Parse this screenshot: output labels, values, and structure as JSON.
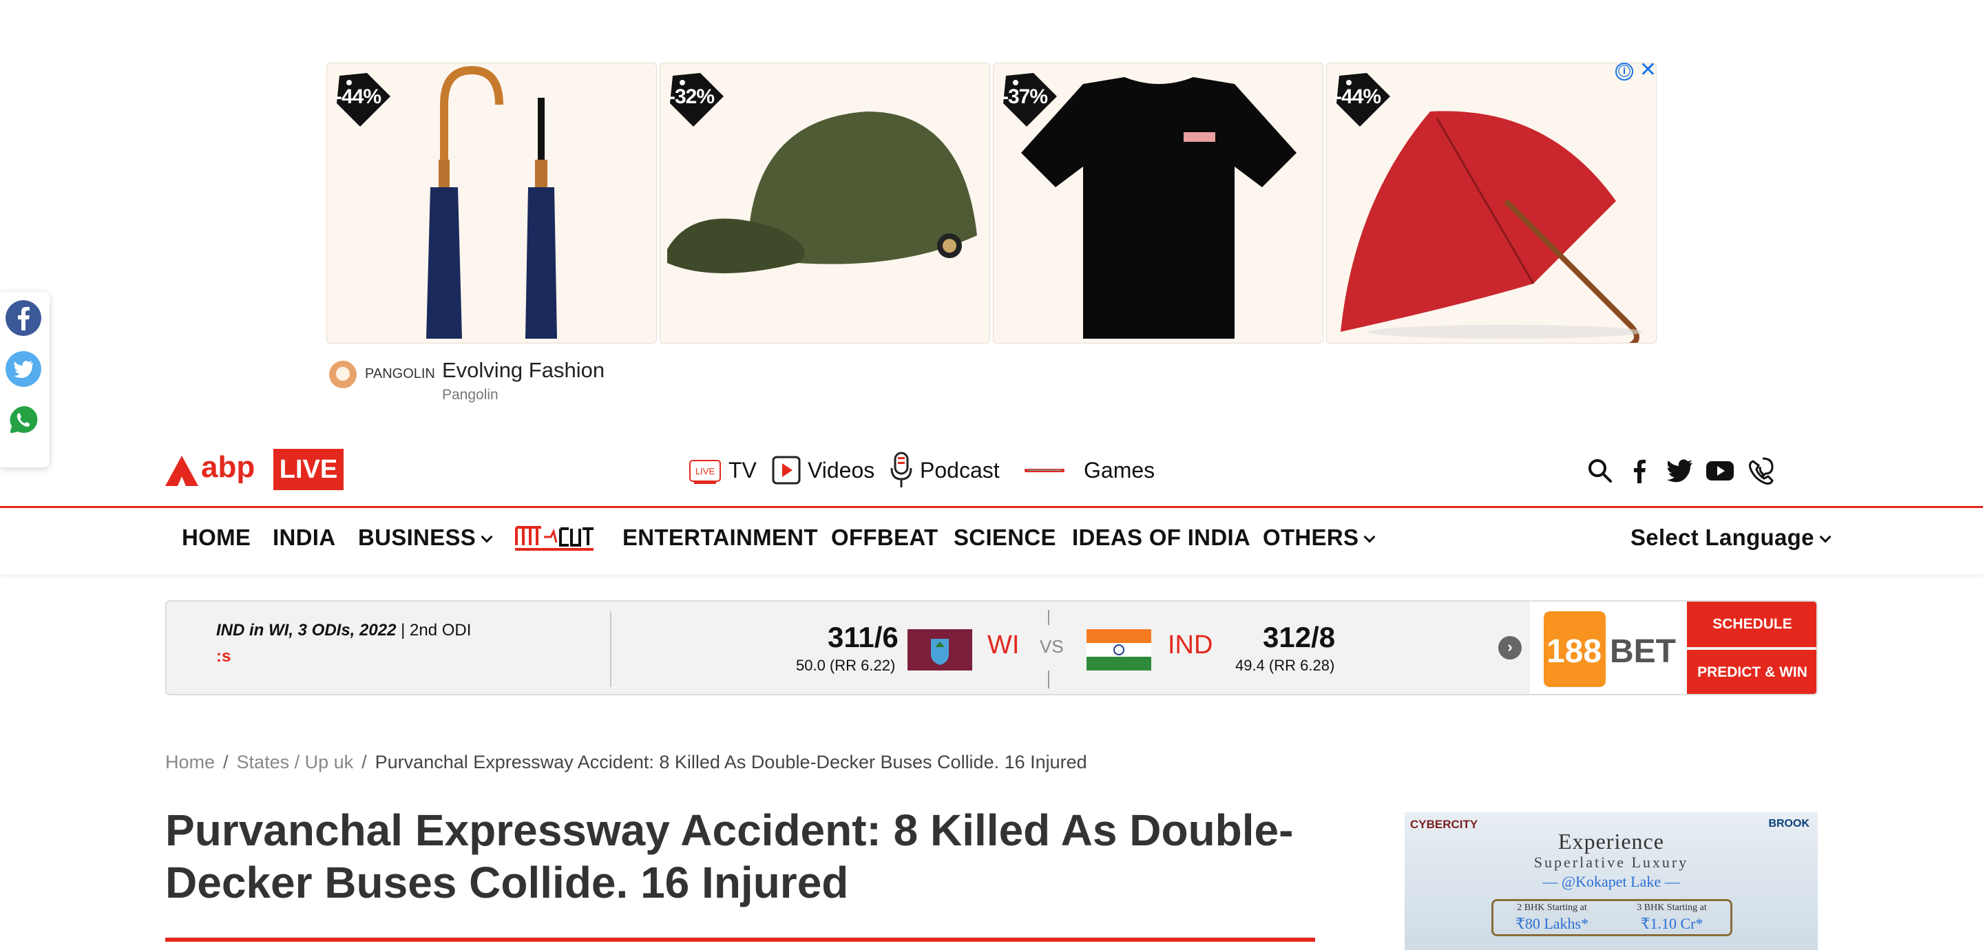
{
  "ad_banner": {
    "discounts": [
      "-44%",
      "-32%",
      "-37%",
      "-44%"
    ],
    "brand": "PANGOLIN",
    "headline": "Evolving Fashion",
    "sub": "Pangolin",
    "info_icon": "ⓘ",
    "close_icon": "✕"
  },
  "share": {
    "icons": [
      "facebook-icon",
      "twitter-icon",
      "whatsapp-icon"
    ]
  },
  "logo": {
    "text": "abp",
    "badge": "LIVE"
  },
  "media_nav": [
    {
      "label": "TV",
      "icon": "live-tv-icon"
    },
    {
      "label": "Videos",
      "icon": "video-play-icon"
    },
    {
      "label": "Podcast",
      "icon": "microphone-icon"
    },
    {
      "label": "Games",
      "icon": "games-icon"
    }
  ],
  "main_nav": {
    "items": [
      "HOME",
      "INDIA",
      "BUSINESS",
      "ENTERTAINMENT",
      "OFFBEAT",
      "SCIENCE",
      "IDEAS OF INDIA",
      "OTHERS"
    ],
    "language": "Select Language"
  },
  "score": {
    "series": "IND in WI, 3 ODIs, 2022",
    "match": "| 2nd ODI",
    "status": ":s",
    "team1": {
      "name": "WI",
      "score": "311/6",
      "overs": "50.0 (RR 6.22)"
    },
    "vs": "VS",
    "team2": {
      "name": "IND",
      "score": "312/8",
      "overs": "49.4 (RR 6.28)"
    },
    "next": "›",
    "sponsor": "188BET",
    "schedule": "SCHEDULE",
    "predict": "PREDICT & WIN"
  },
  "breadcrumb": {
    "home": "Home",
    "states": "States / Up uk",
    "current": "Purvanchal Expressway Accident: 8 Killed As Double-Decker Buses Collide. 16 Injured"
  },
  "article": {
    "headline": "Purvanchal Expressway Accident: 8 Killed As Double-Decker Buses Collide. 16 Injured"
  },
  "side_ad": {
    "logo": "CYBERCITY",
    "title": "Experience",
    "sub": "Superlative Luxury",
    "location": "— @Kokapet Lake —",
    "bhk2": "2 BHK Starting at",
    "bhk2_price": "₹80 Lakhs*",
    "bhk3": "3 BHK Starting at",
    "bhk3_price": "₹1.10 Cr*",
    "brook": "BROOK"
  }
}
